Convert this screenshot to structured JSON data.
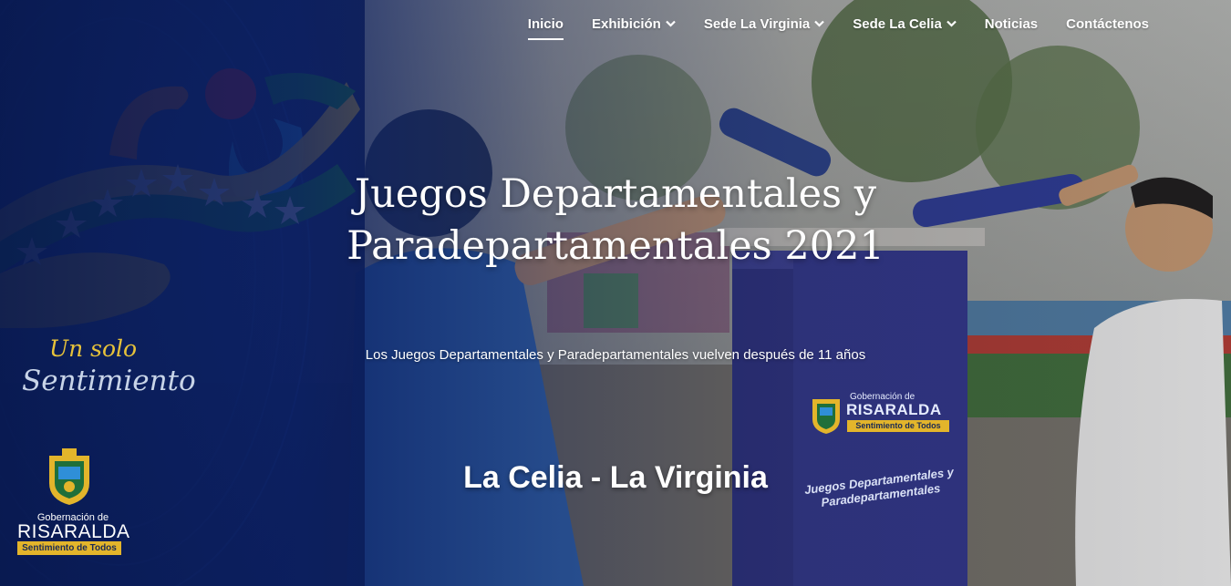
{
  "nav": {
    "items": [
      {
        "label": "Inicio",
        "active": true,
        "dropdown": false
      },
      {
        "label": "Exhibición",
        "active": false,
        "dropdown": true
      },
      {
        "label": "Sede La Virginia",
        "active": false,
        "dropdown": true
      },
      {
        "label": "Sede La Celia",
        "active": false,
        "dropdown": true
      },
      {
        "label": "Noticias",
        "active": false,
        "dropdown": false
      },
      {
        "label": "Contáctenos",
        "active": false,
        "dropdown": false
      }
    ]
  },
  "hero": {
    "title": "Juegos Departamentales y Paradepartamentales 2021",
    "subtitle": "Los Juegos Departamentales y Paradepartamentales vuelven después de 11 años",
    "venues": "La Celia - La Virginia"
  },
  "branding": {
    "slogan_line1": "Un solo",
    "slogan_line2": "Sentimiento",
    "gov_small": "Gobernación de",
    "gov_name": "RISARALDA",
    "gov_tagline": "Sentimiento de Todos"
  },
  "podium_box": {
    "gov_small": "Gobernación de",
    "gov_name": "RISARALDA",
    "gov_tagline": "Sentimiento de Todos",
    "event_text": "Juegos Departamentales y Paradepartamentales"
  },
  "colors": {
    "brand_blue": "#0a1e5f",
    "flag_green": "#1d8a3a",
    "flag_yellow": "#e3b52b",
    "accent_red": "#d8262e",
    "accent_orange": "#e56a1d",
    "accent_sky": "#2f8fd8"
  }
}
